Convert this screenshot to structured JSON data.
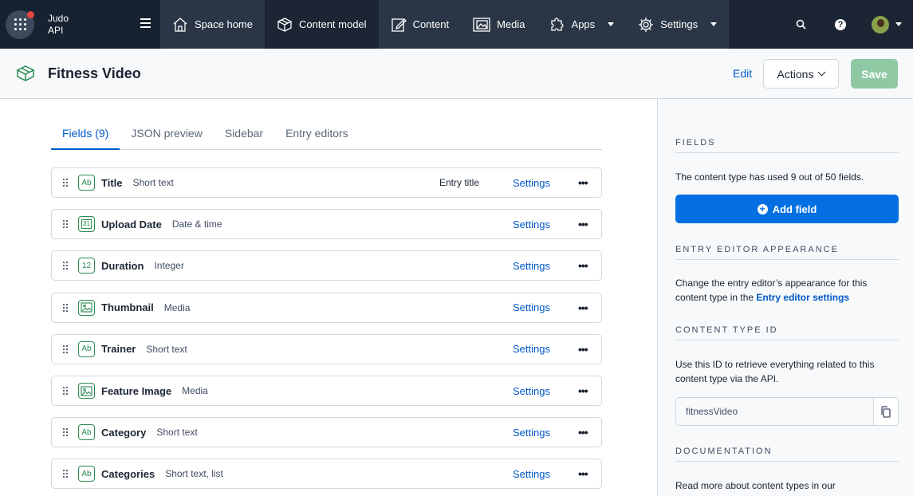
{
  "topnav": {
    "space": {
      "org": "Judo",
      "env": "API"
    },
    "items": [
      {
        "label": "Space home",
        "icon": "home-icon"
      },
      {
        "label": "Content model",
        "icon": "content-model-icon"
      },
      {
        "label": "Content",
        "icon": "content-icon"
      },
      {
        "label": "Media",
        "icon": "media-icon"
      },
      {
        "label": "Apps",
        "icon": "apps-icon"
      },
      {
        "label": "Settings",
        "icon": "gear-icon"
      }
    ],
    "help_label": "?"
  },
  "header": {
    "title": "Fitness Video",
    "edit_label": "Edit",
    "actions_label": "Actions",
    "save_label": "Save"
  },
  "tabs": [
    {
      "label": "Fields (9)"
    },
    {
      "label": "JSON preview"
    },
    {
      "label": "Sidebar"
    },
    {
      "label": "Entry editors"
    }
  ],
  "fields": [
    {
      "type_badge": "Ab",
      "name": "Title",
      "kind": "Short text",
      "entry_title": "Entry title",
      "settings": "Settings",
      "more": "•••"
    },
    {
      "type_badge": "31",
      "name": "Upload Date",
      "kind": "Date & time",
      "entry_title": "",
      "settings": "Settings",
      "more": "•••"
    },
    {
      "type_badge": "12",
      "name": "Duration",
      "kind": "Integer",
      "entry_title": "",
      "settings": "Settings",
      "more": "•••"
    },
    {
      "type_badge": "img",
      "name": "Thumbnail",
      "kind": "Media",
      "entry_title": "",
      "settings": "Settings",
      "more": "•••"
    },
    {
      "type_badge": "Ab",
      "name": "Trainer",
      "kind": "Short text",
      "entry_title": "",
      "settings": "Settings",
      "more": "•••"
    },
    {
      "type_badge": "img",
      "name": "Feature Image",
      "kind": "Media",
      "entry_title": "",
      "settings": "Settings",
      "more": "•••"
    },
    {
      "type_badge": "Ab",
      "name": "Category",
      "kind": "Short text",
      "entry_title": "",
      "settings": "Settings",
      "more": "•••"
    },
    {
      "type_badge": "Ab",
      "name": "Categories",
      "kind": "Short text, list",
      "entry_title": "",
      "settings": "Settings",
      "more": "•••"
    }
  ],
  "sidebar": {
    "fields_heading": "FIELDS",
    "fields_text": "The content type has used 9 out of 50 fields.",
    "add_field_label": "Add field",
    "appearance_heading": "ENTRY EDITOR APPEARANCE",
    "appearance_text": "Change the entry editor’s appearance for this content type in the",
    "appearance_link": "Entry editor settings",
    "id_heading": "CONTENT TYPE ID",
    "id_text": "Use this ID to retrieve everything related to this content type via the API.",
    "id_value": "fitnessVideo",
    "docs_heading": "DOCUMENTATION",
    "docs_text": "Read more about content types in our"
  },
  "colors": {
    "nav_bg": "#1b2533",
    "primary": "#036fe3",
    "link": "#0059c8",
    "save_disabled": "#8fc9a4",
    "field_type": "#2a8a52"
  }
}
